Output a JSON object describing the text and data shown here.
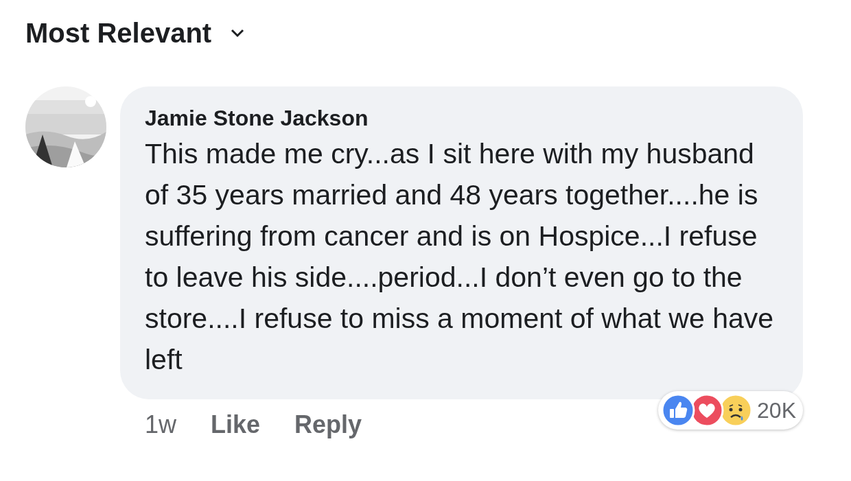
{
  "sort": {
    "label": "Most Relevant"
  },
  "comment": {
    "avatar": {
      "kind": "picture"
    },
    "author": "Jamie Stone Jackson",
    "text": "This made me cry...as I sit here with my husband of 35 years married and 48 years together....he is suffering from cancer and is on Hospice...I refuse to leave his side....period...I don’t even go to the store....I refuse to miss a moment of what we have left",
    "time": "1w",
    "actions": [
      "Like",
      "Reply"
    ],
    "reactions": [
      {
        "kind": "like"
      },
      {
        "kind": "love"
      },
      {
        "kind": "sad"
      }
    ],
    "reaction_count": "20K"
  }
}
